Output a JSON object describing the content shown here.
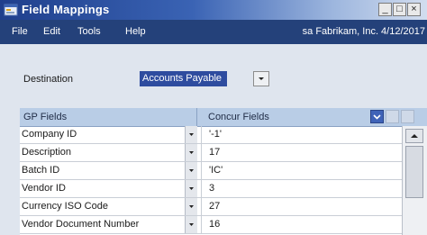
{
  "window": {
    "title": "Field Mappings"
  },
  "title_buttons": [
    "_",
    "□",
    "×"
  ],
  "menu": {
    "items": [
      "File",
      "Edit",
      "Tools",
      "Help"
    ]
  },
  "company_info": "sa  Fabrikam, Inc.  4/12/2017",
  "destination": {
    "label": "Destination",
    "value": "Accounts Payable"
  },
  "grid": {
    "headers": [
      "GP Fields",
      "Concur Fields"
    ],
    "rows": [
      {
        "gp": "Company ID",
        "concur": "'-1'"
      },
      {
        "gp": "Description",
        "concur": "17"
      },
      {
        "gp": "Batch ID",
        "concur": "'IC'"
      },
      {
        "gp": "Vendor ID",
        "concur": "3"
      },
      {
        "gp": "Currency ISO Code",
        "concur": "27"
      },
      {
        "gp": "Vendor Document Number",
        "concur": "16"
      }
    ]
  },
  "colors": {
    "title_bar": "#1f3f8c",
    "menu_bar": "#24417a",
    "grid_header": "#b9cde6",
    "selection": "#2e4c9f"
  },
  "icons": [
    "app-icon",
    "minimize-icon",
    "maximize-icon",
    "close-icon",
    "dropdown-arrow-icon",
    "chevron-down-icon",
    "scroll-up-arrow-icon"
  ]
}
